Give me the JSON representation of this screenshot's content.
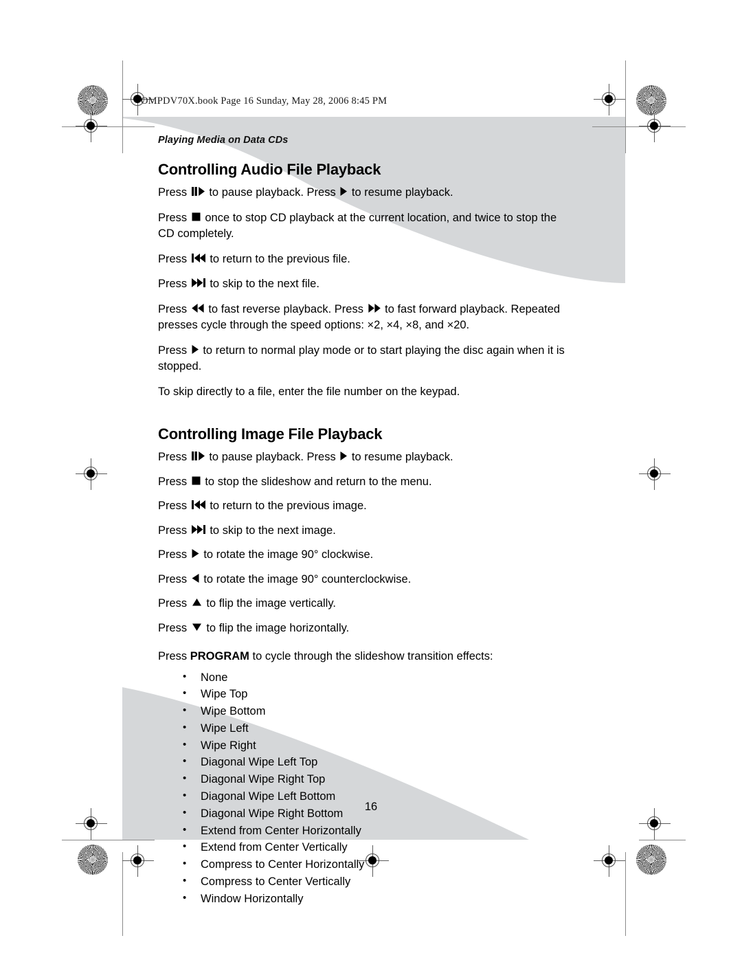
{
  "slug": "OMPDV70X.book  Page 16  Sunday, May 28, 2006  8:45 PM",
  "running_head": "Playing Media on Data CDs",
  "page_number": "16",
  "colors": {
    "decorative_gray": "#d5d7d9",
    "text": "#000000",
    "trim_rule": "#8a8a8a"
  },
  "sections": [
    {
      "title": "Controlling Audio File Playback",
      "paragraphs": [
        {
          "id": "audio-pause",
          "parts": [
            {
              "type": "text",
              "value": "Press "
            },
            {
              "type": "glyph",
              "value": "pause-play-icon"
            },
            {
              "type": "text",
              "value": " to pause playback. Press "
            },
            {
              "type": "glyph",
              "value": "play-icon"
            },
            {
              "type": "text",
              "value": " to resume playback."
            }
          ],
          "plain": "Press ❚❚▶ to pause playback. Press ▶ to resume playback."
        },
        {
          "id": "audio-stop",
          "parts": [
            {
              "type": "text",
              "value": "Press "
            },
            {
              "type": "glyph",
              "value": "stop-icon"
            },
            {
              "type": "text",
              "value": " once to stop CD playback at the current location, and twice to stop the CD completely."
            }
          ],
          "plain": "Press ■ once to stop CD playback at the current location, and twice to stop the CD completely."
        },
        {
          "id": "audio-previous",
          "parts": [
            {
              "type": "text",
              "value": "Press "
            },
            {
              "type": "glyph",
              "value": "previous-track-icon"
            },
            {
              "type": "text",
              "value": " to return to the previous file."
            }
          ],
          "plain": "Press |◀◀ to return to the previous file."
        },
        {
          "id": "audio-next",
          "parts": [
            {
              "type": "text",
              "value": "Press "
            },
            {
              "type": "glyph",
              "value": "next-track-icon"
            },
            {
              "type": "text",
              "value": " to skip to the next file."
            }
          ],
          "plain": "Press ▶▶| to skip to the next file."
        },
        {
          "id": "audio-scan",
          "parts": [
            {
              "type": "text",
              "value": "Press "
            },
            {
              "type": "glyph",
              "value": "fast-reverse-icon"
            },
            {
              "type": "text",
              "value": " to fast reverse playback. Press "
            },
            {
              "type": "glyph",
              "value": "fast-forward-icon"
            },
            {
              "type": "text",
              "value": " to fast forward playback. Repeated presses cycle through the speed options: ×2, ×4, ×8, and ×20."
            }
          ],
          "plain": "Press ◀◀ to fast reverse playback. Press ▶▶ to fast forward playback. Repeated presses cycle through the speed options: ×2, ×4, ×8, and ×20."
        },
        {
          "id": "audio-normal-play",
          "parts": [
            {
              "type": "text",
              "value": "Press "
            },
            {
              "type": "glyph",
              "value": "play-icon"
            },
            {
              "type": "text",
              "value": " to return to normal play mode or to start playing the disc again when it is stopped."
            }
          ],
          "plain": "Press ▶ to return to normal play mode or to start playing the disc again when it is stopped."
        },
        {
          "id": "audio-keypad",
          "parts": [
            {
              "type": "text",
              "value": "To skip directly to a file, enter the file number on the keypad."
            }
          ],
          "plain": "To skip directly to a file, enter the file number on the keypad."
        }
      ]
    },
    {
      "title": "Controlling Image File Playback",
      "paragraphs": [
        {
          "id": "image-pause",
          "parts": [
            {
              "type": "text",
              "value": "Press "
            },
            {
              "type": "glyph",
              "value": "pause-play-icon"
            },
            {
              "type": "text",
              "value": " to pause playback. Press "
            },
            {
              "type": "glyph",
              "value": "play-icon"
            },
            {
              "type": "text",
              "value": " to resume playback."
            }
          ],
          "plain": "Press ❚❚▶ to pause playback. Press ▶ to resume playback."
        },
        {
          "id": "image-stop",
          "parts": [
            {
              "type": "text",
              "value": "Press "
            },
            {
              "type": "glyph",
              "value": "stop-icon"
            },
            {
              "type": "text",
              "value": " to stop the slideshow and return to the menu."
            }
          ],
          "plain": "Press ■ to stop the slideshow and return to the menu."
        },
        {
          "id": "image-previous",
          "parts": [
            {
              "type": "text",
              "value": "Press "
            },
            {
              "type": "glyph",
              "value": "previous-track-icon"
            },
            {
              "type": "text",
              "value": " to return to the previous image."
            }
          ],
          "plain": "Press |◀◀ to return to the previous image."
        },
        {
          "id": "image-next",
          "parts": [
            {
              "type": "text",
              "value": "Press "
            },
            {
              "type": "glyph",
              "value": "next-track-icon"
            },
            {
              "type": "text",
              "value": " to skip to the next image."
            }
          ],
          "plain": "Press ▶▶| to skip to the next image."
        },
        {
          "id": "image-rotate-cw",
          "parts": [
            {
              "type": "text",
              "value": "Press "
            },
            {
              "type": "glyph",
              "value": "right-arrow-icon"
            },
            {
              "type": "text",
              "value": " to rotate the image 90° clockwise."
            }
          ],
          "plain": "Press ▶ to rotate the image 90° clockwise."
        },
        {
          "id": "image-rotate-ccw",
          "parts": [
            {
              "type": "text",
              "value": "Press "
            },
            {
              "type": "glyph",
              "value": "left-arrow-icon"
            },
            {
              "type": "text",
              "value": " to rotate the image 90° counterclockwise."
            }
          ],
          "plain": "Press ◀ to rotate the image 90° counterclockwise."
        },
        {
          "id": "image-flip-vertical",
          "parts": [
            {
              "type": "text",
              "value": "Press "
            },
            {
              "type": "glyph",
              "value": "up-arrow-icon"
            },
            {
              "type": "text",
              "value": " to flip the image vertically."
            }
          ],
          "plain": "Press ▲ to flip the image vertically."
        },
        {
          "id": "image-flip-horizontal",
          "parts": [
            {
              "type": "text",
              "value": "Press "
            },
            {
              "type": "glyph",
              "value": "down-arrow-icon"
            },
            {
              "type": "text",
              "value": " to flip the image horizontally."
            }
          ],
          "plain": "Press ▼ to flip the image horizontally."
        },
        {
          "id": "image-program",
          "parts": [
            {
              "type": "text",
              "value": "Press "
            },
            {
              "type": "bold",
              "value": "PROGRAM"
            },
            {
              "type": "text",
              "value": " to cycle through the slideshow transition effects:"
            }
          ],
          "plain": "Press PROGRAM to cycle through the slideshow transition effects:"
        }
      ],
      "transition_effects": [
        "None",
        "Wipe Top",
        "Wipe Bottom",
        "Wipe Left",
        "Wipe Right",
        "Diagonal Wipe Left Top",
        "Diagonal Wipe Right Top",
        "Diagonal Wipe Left Bottom",
        "Diagonal Wipe Right Bottom",
        "Extend from Center Horizontally",
        "Extend from Center Vertically",
        "Compress to Center Horizontally",
        "Compress to Center Vertically",
        "Window Horizontally"
      ]
    }
  ]
}
